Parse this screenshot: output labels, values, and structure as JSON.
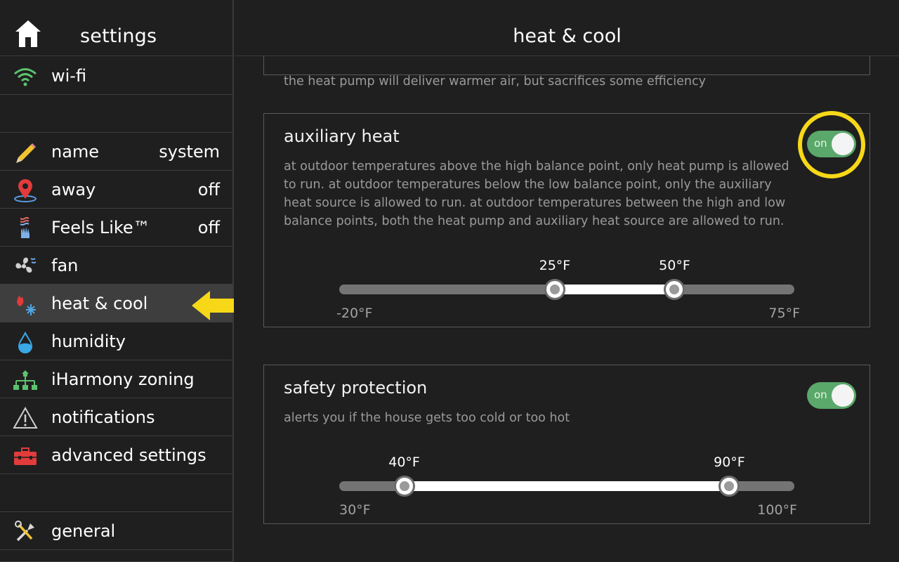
{
  "sidebar": {
    "title": "settings",
    "items": [
      {
        "key": "wifi",
        "label": "wi-fi",
        "value": "",
        "icon": "wifi-icon"
      },
      {
        "key": "name",
        "label": "name",
        "value": "system",
        "icon": "pencil-icon"
      },
      {
        "key": "away",
        "label": "away",
        "value": "off",
        "icon": "map-pin-icon"
      },
      {
        "key": "feels",
        "label": "Feels Like™",
        "value": "off",
        "icon": "hand-heat-icon"
      },
      {
        "key": "fan",
        "label": "fan",
        "value": "",
        "icon": "fan-icon"
      },
      {
        "key": "heatcool",
        "label": "heat & cool",
        "value": "",
        "icon": "flame-snowflake-icon",
        "active": true
      },
      {
        "key": "humidity",
        "label": "humidity",
        "value": "",
        "icon": "water-drop-icon"
      },
      {
        "key": "zoning",
        "label": "iHarmony zoning",
        "value": "",
        "icon": "zoning-tree-icon"
      },
      {
        "key": "notifications",
        "label": "notifications",
        "value": "",
        "icon": "warning-triangle-icon"
      },
      {
        "key": "advanced",
        "label": "advanced settings",
        "value": "",
        "icon": "toolbox-icon"
      },
      {
        "key": "general",
        "label": "general",
        "value": "",
        "icon": "tools-icon"
      }
    ]
  },
  "main": {
    "title": "heat & cool",
    "prev_card_desc": "the heat pump will deliver warmer air, but sacrifices some efficiency",
    "auxiliary": {
      "title": "auxiliary heat",
      "description": "at outdoor temperatures above the high balance point, only heat pump is allowed to run. at outdoor temperatures below the low balance point, only the auxiliary heat source is allowed to run. at outdoor temperatures between the high and low balance points, both the heat pump and auxiliary heat source are allowed to run.",
      "toggle_label": "on",
      "toggle_on": true,
      "slider": {
        "min": -20,
        "max": 75,
        "low": 25,
        "high": 50,
        "min_label": "-20°F",
        "max_label": "75°F",
        "low_label": "25°F",
        "high_label": "50°F"
      }
    },
    "safety": {
      "title": "safety protection",
      "description": "alerts you if the house gets too cold or too hot",
      "toggle_label": "on",
      "toggle_on": true,
      "slider": {
        "min": 30,
        "max": 100,
        "low": 40,
        "high": 90,
        "min_label": "30°F",
        "max_label": "100°F",
        "low_label": "40°F",
        "high_label": "90°F"
      }
    }
  },
  "colors": {
    "accent_green": "#5aa86a",
    "highlight_yellow": "#f7d818",
    "background": "#1f1f1f",
    "active_row": "#3e3e3e"
  }
}
